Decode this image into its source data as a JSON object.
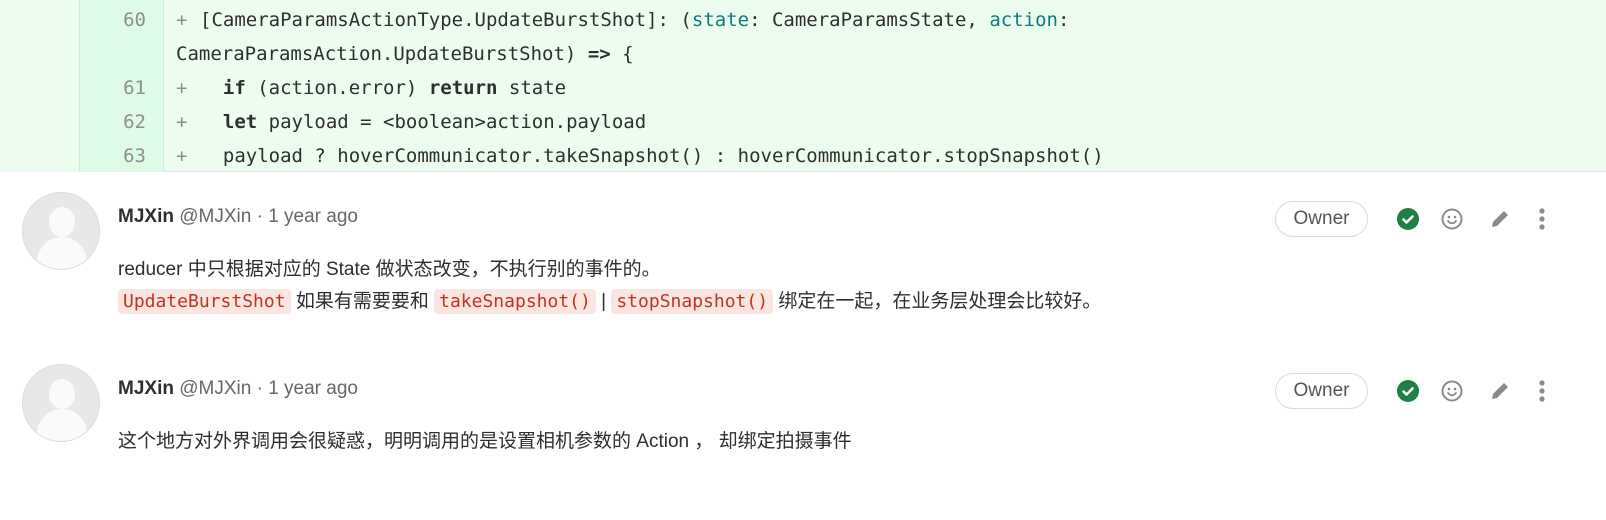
{
  "diff": {
    "lines": [
      {
        "num": "60",
        "sign": "+",
        "parts": [
          {
            "t": "[CameraParamsActionType.UpdateBurstShot]: (",
            "s": ""
          },
          {
            "t": "state",
            "s": "tl"
          },
          {
            "t": ": CameraParamsState, ",
            "s": ""
          },
          {
            "t": "action",
            "s": "tl"
          },
          {
            "t": ":",
            "s": ""
          }
        ],
        "cont": "CameraParamsAction.UpdateBurstShot) => {"
      },
      {
        "num": "61",
        "sign": "+",
        "parts": [
          {
            "t": "  ",
            "s": ""
          },
          {
            "t": "if",
            "s": "kw"
          },
          {
            "t": " (action.error) ",
            "s": ""
          },
          {
            "t": "return",
            "s": "kw"
          },
          {
            "t": " state",
            "s": ""
          }
        ]
      },
      {
        "num": "62",
        "sign": "+",
        "parts": [
          {
            "t": "  ",
            "s": ""
          },
          {
            "t": "let",
            "s": "kw"
          },
          {
            "t": " payload = <boolean>action.payload",
            "s": ""
          }
        ]
      },
      {
        "num": "63",
        "sign": "+",
        "parts": [
          {
            "t": "  payload ? hoverCommunicator.takeSnapshot() : hoverCommunicator.stopSnapshot()",
            "s": ""
          }
        ]
      }
    ]
  },
  "notes": [
    {
      "author": "MJXin",
      "handle": "@MJXin",
      "time": "· 1 year ago",
      "badge": "Owner",
      "line1": "reducer 中只根据对应的 State 做状态改变，不执行别的事件的。",
      "line2": [
        {
          "t": "UpdateBurstShot",
          "code": true
        },
        {
          "t": " 如果有需要要和 ",
          "code": false
        },
        {
          "t": "takeSnapshot()",
          "code": true
        },
        {
          "t": " | ",
          "code": false
        },
        {
          "t": "stopSnapshot()",
          "code": true
        },
        {
          "t": " 绑定在一起，在业务层处理会比较好。",
          "code": false
        }
      ]
    },
    {
      "author": "MJXin",
      "handle": "@MJXin",
      "time": "· 1 year ago",
      "badge": "Owner",
      "line1": "这个地方对外界调用会很疑惑，明明调用的是设置相机参数的 Action ， 却绑定拍摄事件"
    }
  ],
  "colors": {
    "resolved": "#1f7f45",
    "icon": "#8a8a8a"
  }
}
